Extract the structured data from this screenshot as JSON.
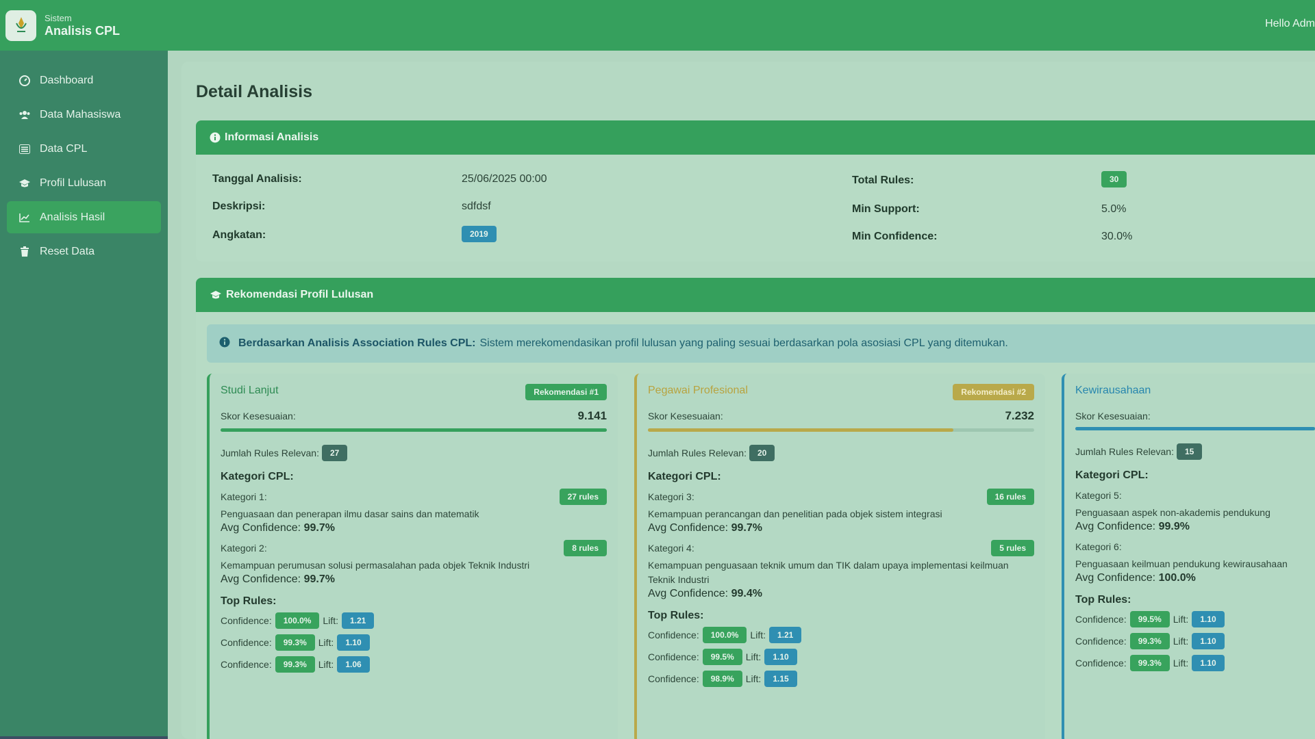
{
  "brand": {
    "subtitle": "Sistem",
    "title": "Analisis CPL"
  },
  "header": {
    "greeting": "Hello Adm"
  },
  "sidebar": {
    "items": [
      {
        "label": "Dashboard",
        "icon": "dashboard-icon"
      },
      {
        "label": "Data Mahasiswa",
        "icon": "users-icon"
      },
      {
        "label": "Data CPL",
        "icon": "list-icon"
      },
      {
        "label": "Profil Lulusan",
        "icon": "graduation-cap-icon"
      },
      {
        "label": "Analisis Hasil",
        "icon": "chart-line-icon",
        "active": true
      },
      {
        "label": "Reset Data",
        "icon": "trash-icon"
      }
    ]
  },
  "page": {
    "title": "Detail Analisis"
  },
  "info": {
    "header": "Informasi Analisis",
    "tanggal_label": "Tanggal Analisis:",
    "tanggal_value": "25/06/2025 00:00",
    "deskripsi_label": "Deskripsi:",
    "deskripsi_value": "sdfdsf",
    "angkatan_label": "Angkatan:",
    "angkatan_value": "2019",
    "total_rules_label": "Total Rules:",
    "total_rules_value": "30",
    "min_support_label": "Min Support:",
    "min_support_value": "5.0%",
    "min_confidence_label": "Min Confidence:",
    "min_confidence_value": "30.0%"
  },
  "rekomendasi": {
    "header": "Rekomendasi Profil Lulusan",
    "alert_bold": "Berdasarkan Analisis Association Rules CPL:",
    "alert_text": "Sistem merekomendasikan profil lulusan yang paling sesuai berdasarkan pola asosiasi CPL yang ditemukan.",
    "labels": {
      "skor": "Skor Kesesuaian:",
      "jumlah_rules": "Jumlah Rules Relevan:",
      "kategori": "Kategori CPL:",
      "top_rules": "Top Rules:",
      "avg_confidence": "Avg Confidence:",
      "confidence": "Confidence:",
      "lift": "Lift:"
    },
    "profiles": [
      {
        "name": "Studi Lanjut",
        "badge": "Rekomendasi #1",
        "score": "9.141",
        "score_fraction": 1.0,
        "rules_count": "27",
        "categories": [
          {
            "label": "Kategori 1:",
            "rules": "27 rules",
            "desc": "Penguasaan dan penerapan ilmu dasar sains dan matematik",
            "avg": "99.7%"
          },
          {
            "label": "Kategori 2:",
            "rules": "8 rules",
            "desc": "Kemampuan perumusan solusi permasalahan pada objek Teknik Industri",
            "avg": "99.7%"
          }
        ],
        "top_rules": [
          {
            "confidence": "100.0%",
            "lift": "1.21"
          },
          {
            "confidence": "99.3%",
            "lift": "1.10"
          },
          {
            "confidence": "99.3%",
            "lift": "1.06"
          }
        ]
      },
      {
        "name": "Pegawai Profesional",
        "badge": "Rekomendasi #2",
        "score": "7.232",
        "score_fraction": 0.79,
        "rules_count": "20",
        "categories": [
          {
            "label": "Kategori 3:",
            "rules": "16 rules",
            "desc": "Kemampuan perancangan dan penelitian pada objek sistem integrasi",
            "avg": "99.7%"
          },
          {
            "label": "Kategori 4:",
            "rules": "5 rules",
            "desc": "Kemampuan penguasaan teknik umum dan TIK dalam upaya implementasi keilmuan Teknik Industri",
            "avg": "99.4%"
          }
        ],
        "top_rules": [
          {
            "confidence": "100.0%",
            "lift": "1.21"
          },
          {
            "confidence": "99.5%",
            "lift": "1.10"
          },
          {
            "confidence": "98.9%",
            "lift": "1.15"
          }
        ]
      },
      {
        "name": "Kewirausahaan",
        "badge": "",
        "score": "",
        "score_fraction": 0.62,
        "rules_count": "15",
        "categories": [
          {
            "label": "Kategori 5:",
            "rules": "",
            "desc": "Penguasaan aspek non-akademis pendukung",
            "avg": "99.9%"
          },
          {
            "label": "Kategori 6:",
            "rules": "",
            "desc": "Penguasaan keilmuan pendukung kewirausahaan",
            "avg": "100.0%"
          }
        ],
        "top_rules": [
          {
            "confidence": "99.5%",
            "lift": "1.10"
          },
          {
            "confidence": "99.3%",
            "lift": "1.10"
          },
          {
            "confidence": "99.3%",
            "lift": "1.10"
          }
        ]
      }
    ]
  },
  "colors": {
    "green": "#35a05c",
    "gold": "#b9a94a",
    "blue": "#2f8fb2"
  }
}
